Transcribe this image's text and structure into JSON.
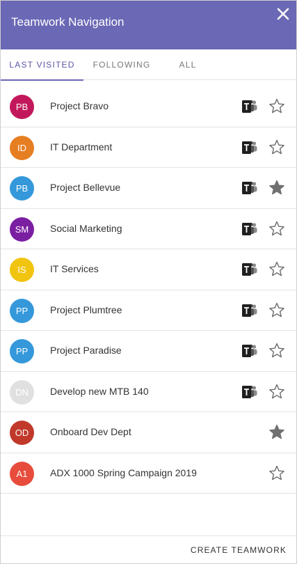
{
  "header": {
    "title": "Teamwork Navigation"
  },
  "tabs": [
    {
      "label": "LAST VISITED"
    },
    {
      "label": "FOLLOWING"
    },
    {
      "label": "ALL"
    }
  ],
  "items": [
    {
      "initials": "PB",
      "name": "Project Bravo",
      "color": "#c2185b",
      "teams": true,
      "favorite": false
    },
    {
      "initials": "ID",
      "name": "IT Department",
      "color": "#e67e22",
      "teams": true,
      "favorite": false
    },
    {
      "initials": "PB",
      "name": "Project Bellevue",
      "color": "#3498db",
      "teams": true,
      "favorite": true
    },
    {
      "initials": "SM",
      "name": "Social Marketing",
      "color": "#7b1fa2",
      "teams": true,
      "favorite": false
    },
    {
      "initials": "IS",
      "name": "IT Services",
      "color": "#f1c40f",
      "teams": true,
      "favorite": false
    },
    {
      "initials": "PP",
      "name": "Project Plumtree",
      "color": "#3498db",
      "teams": true,
      "favorite": false
    },
    {
      "initials": "PP",
      "name": "Project Paradise",
      "color": "#3498db",
      "teams": true,
      "favorite": false
    },
    {
      "initials": "DN",
      "name": "Develop new MTB 140",
      "color": "#e0e0e0",
      "teams": true,
      "favorite": false
    },
    {
      "initials": "OD",
      "name": "Onboard Dev Dept",
      "color": "#c0392b",
      "teams": false,
      "favorite": true
    },
    {
      "initials": "A1",
      "name": "ADX 1000 Spring Campaign 2019",
      "color": "#e74c3c",
      "teams": false,
      "favorite": false
    }
  ],
  "footer": {
    "create_label": "CREATE TEAMWORK"
  },
  "colors": {
    "header": "#6b68b5",
    "accent": "#5b57a6",
    "star_filled": "#707070"
  }
}
